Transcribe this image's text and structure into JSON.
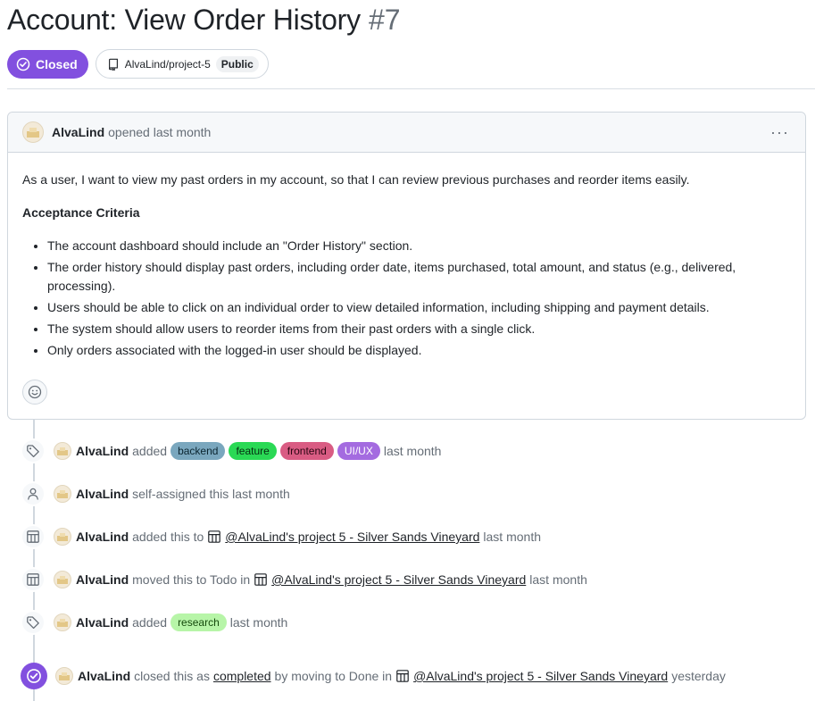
{
  "issue": {
    "title": "Account: View Order History",
    "number": "#7",
    "state": "Closed",
    "repo": "AlvaLind/project-5",
    "visibility": "Public"
  },
  "comment": {
    "author": "AlvaLind",
    "opened": "opened last month",
    "menu_label": "···",
    "intro": "As a user, I want to view my past orders in my account, so that I can review previous purchases and reorder items easily.",
    "heading": "Acceptance Criteria",
    "criteria": [
      "The account dashboard should include an \"Order History\" section.",
      "The order history should display past orders, including order date, items purchased, total amount, and status (e.g., delivered, processing).",
      "Users should be able to click on an individual order to view detailed information, including shipping and payment details.",
      "The system should allow users to reorder items from their past orders with a single click.",
      "Only orders associated with the logged-in user should be displayed."
    ]
  },
  "timeline": [
    {
      "icon": "tag-icon",
      "author": "AlvaLind",
      "action": "added",
      "labels": [
        "backend",
        "feature",
        "frontend",
        "UI/UX"
      ],
      "time": "last month"
    },
    {
      "icon": "person-icon",
      "author": "AlvaLind",
      "action": "self-assigned this last month"
    },
    {
      "icon": "project-icon",
      "author": "AlvaLind",
      "action": "added this to",
      "project": "@AlvaLind's project 5 - Silver Sands Vineyard",
      "time": "last month"
    },
    {
      "icon": "project-icon",
      "author": "AlvaLind",
      "action": "moved this to Todo in",
      "project": "@AlvaLind's project 5 - Silver Sands Vineyard",
      "time": "last month"
    },
    {
      "icon": "tag-icon",
      "author": "AlvaLind",
      "action": "added",
      "labels": [
        "research"
      ],
      "time": "last month"
    },
    {
      "icon": "closed-check-icon",
      "author": "AlvaLind",
      "action": "closed this as",
      "link": "completed",
      "action2": "by moving to Done in",
      "project": "@AlvaLind's project 5 - Silver Sands Vineyard",
      "time": "yesterday"
    }
  ],
  "colors": {
    "closed_purple": "#8250df",
    "label_backend": "#7aa7be",
    "label_feature": "#2ad955",
    "label_frontend": "#d95c83",
    "label_uiux": "#a46be0",
    "label_research": "#b7f5a8"
  }
}
